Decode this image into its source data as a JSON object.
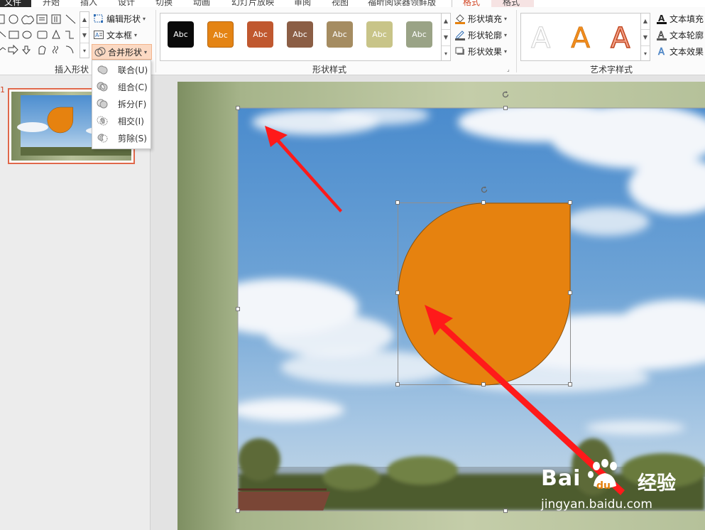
{
  "tabs": {
    "file": "文件",
    "items": [
      "开始",
      "插入",
      "设计",
      "切换",
      "动画",
      "幻灯片放映",
      "审阅",
      "视图",
      "福昕阅读器领鲜版",
      "格式",
      "格式"
    ],
    "active_index": 9
  },
  "ribbon": {
    "insert_shapes": {
      "label": "插入形状",
      "edit_shape": "编辑形状",
      "text_box": "文本框",
      "merge_shapes": "合并形状"
    },
    "shape_styles": {
      "label": "形状样式",
      "swatch_text": "Abc",
      "swatch_colors": [
        "#0a0a0a",
        "#e48414",
        "#c0582f",
        "#8b5e45",
        "#a58c61",
        "#c8c488",
        "#9aa386"
      ],
      "fill": "形状填充",
      "outline": "形状轮廓",
      "effects": "形状效果"
    },
    "wordart": {
      "label": "艺术字样式",
      "sample_letter": "A",
      "text_fill": "文本填充",
      "text_outline": "文本轮廓",
      "text_effects": "文本效果"
    }
  },
  "merge_menu": {
    "items": [
      "联合(U)",
      "组合(C)",
      "拆分(F)",
      "相交(I)",
      "剪除(S)"
    ]
  },
  "thumbnails": {
    "slide_number": "1"
  },
  "colors": {
    "accent": "#d24726",
    "shape_fill": "#e6820f",
    "arrow": "#ff1a1a"
  },
  "watermark": {
    "brand": "Bai",
    "brand_cn": "经验",
    "url": "jingyan.baidu.com"
  }
}
